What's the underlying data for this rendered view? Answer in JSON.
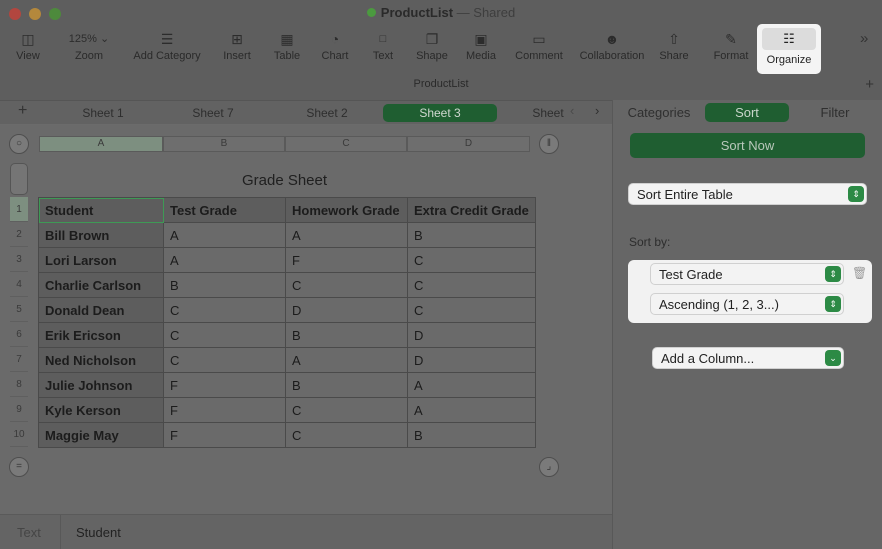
{
  "window": {
    "title": "ProductList",
    "separator": "—",
    "shared": "Shared",
    "file_label": "ProductList"
  },
  "toolbar": {
    "view": "View",
    "zoom_value": "125%",
    "zoom": "Zoom",
    "add_category": "Add Category",
    "insert": "Insert",
    "table": "Table",
    "chart": "Chart",
    "text": "Text",
    "shape": "Shape",
    "media": "Media",
    "comment": "Comment",
    "collaboration": "Collaboration",
    "share": "Share",
    "format": "Format",
    "organize": "Organize"
  },
  "tabs": {
    "sheet1": "Sheet 1",
    "sheet7": "Sheet 7",
    "sheet2": "Sheet 2",
    "sheet3": "Sheet 3",
    "sheet_partial": "Sheet"
  },
  "columns": [
    "A",
    "B",
    "C",
    "D"
  ],
  "row_numbers": [
    "1",
    "2",
    "3",
    "4",
    "5",
    "6",
    "7",
    "8",
    "9",
    "10"
  ],
  "sheet": {
    "title": "Grade Sheet",
    "headers": [
      "Student",
      "Test Grade",
      "Homework Grade",
      "Extra Credit Grade"
    ],
    "rows": [
      [
        "Bill Brown",
        "A",
        "A",
        "B"
      ],
      [
        "Lori Larson",
        "A",
        "F",
        "C"
      ],
      [
        "Charlie Carlson",
        "B",
        "C",
        "C"
      ],
      [
        "Donald Dean",
        "C",
        "D",
        "C"
      ],
      [
        "Erik Ericson",
        "C",
        "B",
        "D"
      ],
      [
        "Ned Nicholson",
        "C",
        "A",
        "D"
      ],
      [
        "Julie Johnson",
        "F",
        "B",
        "A"
      ],
      [
        "Kyle Kerson",
        "F",
        "C",
        "A"
      ],
      [
        "Maggie May",
        "F",
        "C",
        "B"
      ]
    ]
  },
  "status": {
    "text": "Text",
    "student": "Student"
  },
  "sidebar": {
    "categories": "Categories",
    "sort": "Sort",
    "filter": "Filter",
    "sort_now": "Sort Now",
    "scope": "Sort Entire Table",
    "sort_by": "Sort by:",
    "sort_column": "Test Grade",
    "sort_order": "Ascending (1, 2, 3...)",
    "add_column": "Add a Column..."
  },
  "colors": {
    "accent_green": "#1f5e31",
    "popup_arrow_green": "#2c8a45"
  }
}
